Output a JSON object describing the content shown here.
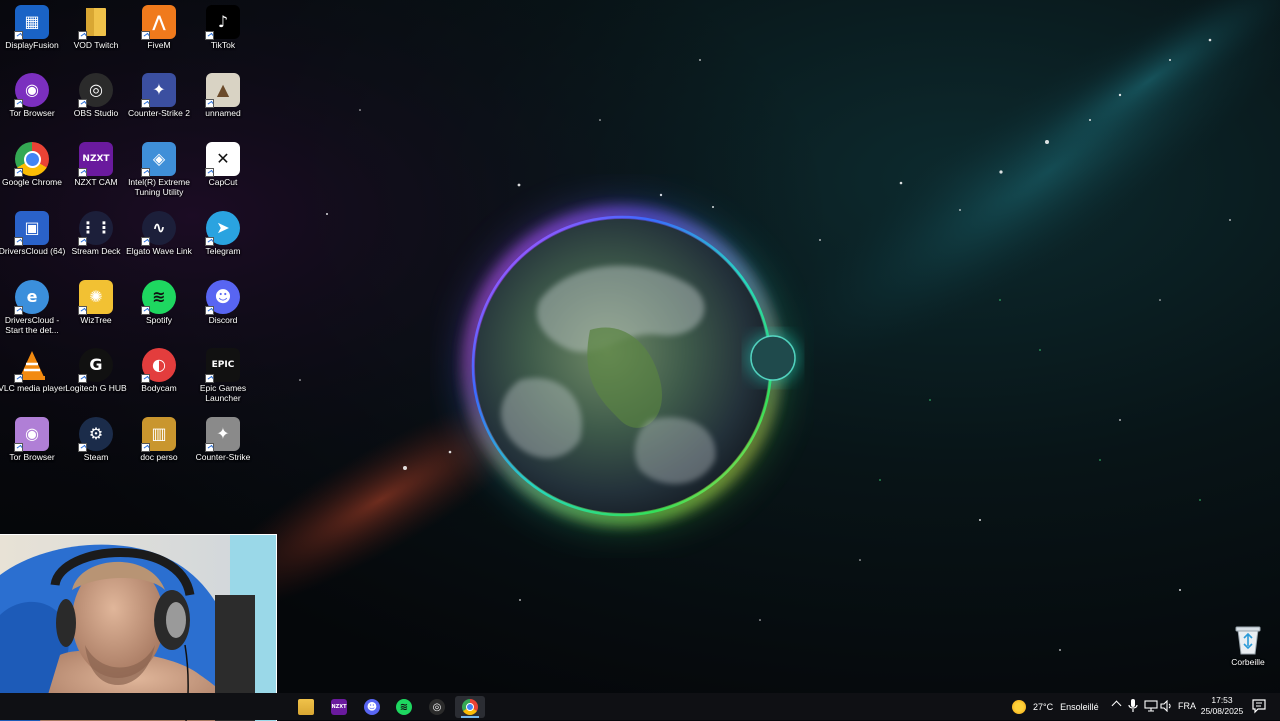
{
  "desktop": {
    "icons": [
      {
        "label": "DisplayFusion",
        "icon": "displayfusion-icon",
        "bg": "#1a63c6"
      },
      {
        "label": "VOD Twitch",
        "icon": "folder-icon",
        "bg": "#e8b739"
      },
      {
        "label": "FiveM",
        "icon": "fivem-icon",
        "bg": "#f07a1c"
      },
      {
        "label": "TikTok",
        "icon": "tiktok-icon",
        "bg": "#000000"
      },
      {
        "label": "Tor Browser",
        "icon": "tor-browser-icon",
        "bg": "#7b2fbf"
      },
      {
        "label": "OBS Studio",
        "icon": "obs-studio-icon",
        "bg": "#2b2b2b"
      },
      {
        "label": "Counter-Strike 2",
        "icon": "counter-strike-icon",
        "bg": "#3b4fa0"
      },
      {
        "label": "unnamed",
        "icon": "image-file-icon",
        "bg": "#d9d3c4"
      },
      {
        "label": "Google Chrome",
        "icon": "chrome-icon",
        "bg": "#ffffff"
      },
      {
        "label": "NZXT CAM",
        "icon": "nzxt-cam-icon",
        "bg": "#6a1a9e",
        "glyph": "NZXT"
      },
      {
        "label": "Intel(R) Extreme Tuning Utility",
        "icon": "intel-xtu-icon",
        "bg": "#3f8fd8"
      },
      {
        "label": "CapCut",
        "icon": "capcut-icon",
        "bg": "#ffffff"
      },
      {
        "label": "DriversCloud (64)",
        "icon": "driverscloud-icon",
        "bg": "#2a62c9"
      },
      {
        "label": "Stream Deck",
        "icon": "stream-deck-icon",
        "bg": "#1c1f3a"
      },
      {
        "label": "Elgato Wave Link",
        "icon": "wave-link-icon",
        "bg": "#1c1f3a"
      },
      {
        "label": "Telegram",
        "icon": "telegram-icon",
        "bg": "#2aa3e0"
      },
      {
        "label": "DriversCloud - Start the det...",
        "icon": "driverscloud-web-icon",
        "bg": "#3b8fdc"
      },
      {
        "label": "WizTree",
        "icon": "wiztree-icon",
        "bg": "#f2c133"
      },
      {
        "label": "Spotify",
        "icon": "spotify-icon",
        "bg": "#1ed760"
      },
      {
        "label": "Discord",
        "icon": "discord-icon",
        "bg": "#5865f2"
      },
      {
        "label": "VLC media player",
        "icon": "vlc-icon",
        "bg": "transparent"
      },
      {
        "label": "Logitech G HUB",
        "icon": "logitech-ghub-icon",
        "bg": "#111111"
      },
      {
        "label": "Bodycam",
        "icon": "bodycam-icon",
        "bg": "#e33d3d"
      },
      {
        "label": "Epic Games Launcher",
        "icon": "epic-games-icon",
        "bg": "#111111",
        "glyph": "EPIC"
      },
      {
        "label": "Tor Browser",
        "icon": "tor-browser-file-icon",
        "bg": "#b07fd6"
      },
      {
        "label": "Steam",
        "icon": "steam-icon",
        "bg": "#1b2c4a"
      },
      {
        "label": "doc perso",
        "icon": "archive-icon",
        "bg": "#c9962e"
      },
      {
        "label": "Counter-Strike",
        "icon": "counter-strike-classic-icon",
        "bg": "#8a8a8a"
      }
    ]
  },
  "recycle_bin": {
    "label": "Corbeille",
    "icon": "recycle-bin-icon"
  },
  "taskbar": {
    "apps": [
      {
        "name": "file-explorer",
        "icon": "folder-icon",
        "bg": "#e8b739",
        "active": false
      },
      {
        "name": "nzxt-cam",
        "icon": "nzxt-cam-icon",
        "bg": "#6a1a9e",
        "active": false
      },
      {
        "name": "discord",
        "icon": "discord-icon",
        "bg": "#5865f2",
        "active": false
      },
      {
        "name": "spotify",
        "icon": "spotify-icon",
        "bg": "#1ed760",
        "active": false
      },
      {
        "name": "obs-studio",
        "icon": "obs-studio-icon",
        "bg": "#2b2b2b",
        "active": false
      },
      {
        "name": "google-chrome",
        "icon": "chrome-icon",
        "bg": "#ffffff",
        "active": true
      }
    ],
    "weather": {
      "temperature": "27°C",
      "condition": "Ensoleillé",
      "icon": "sun-icon"
    },
    "language": "FRA",
    "time": "17:53",
    "date": "25/08/2025"
  },
  "colors": {
    "taskbar": "#0f1014",
    "accent": "#76b9ed",
    "ring_blue": "#3a6bff",
    "ring_green": "#33e05a",
    "ring_red": "#ff3a2a"
  }
}
